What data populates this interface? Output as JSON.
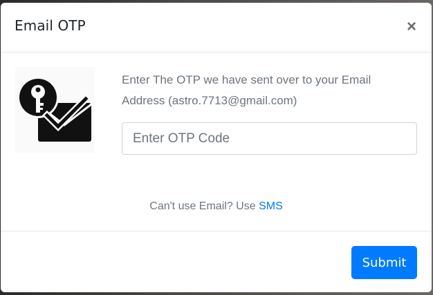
{
  "modal": {
    "title": "Email OTP",
    "close_symbol": "×",
    "message": "Enter The OTP we have sent over to your Email Address (astro.7713@gmail.com)",
    "otp_input": {
      "value": "",
      "placeholder": "Enter OTP Code"
    },
    "alternative": {
      "prefix": "Can't use Email? Use ",
      "link_label": "SMS"
    },
    "submit_label": "Submit",
    "illustration_icon": "key-envelope-check-icon"
  },
  "colors": {
    "primary": "#007bff",
    "text_muted": "#6c757d",
    "title": "#212529"
  }
}
